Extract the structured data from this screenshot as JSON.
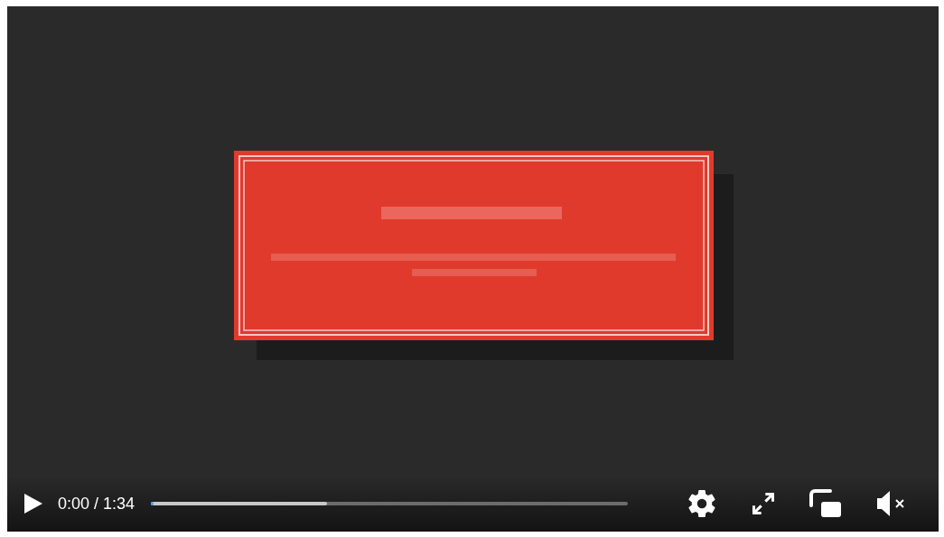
{
  "controls": {
    "playing": false,
    "time": "0:00 / 1:34",
    "progress": {
      "level": 0.004
    },
    "buffer": {
      "level": 0.37
    },
    "muted": true
  }
}
